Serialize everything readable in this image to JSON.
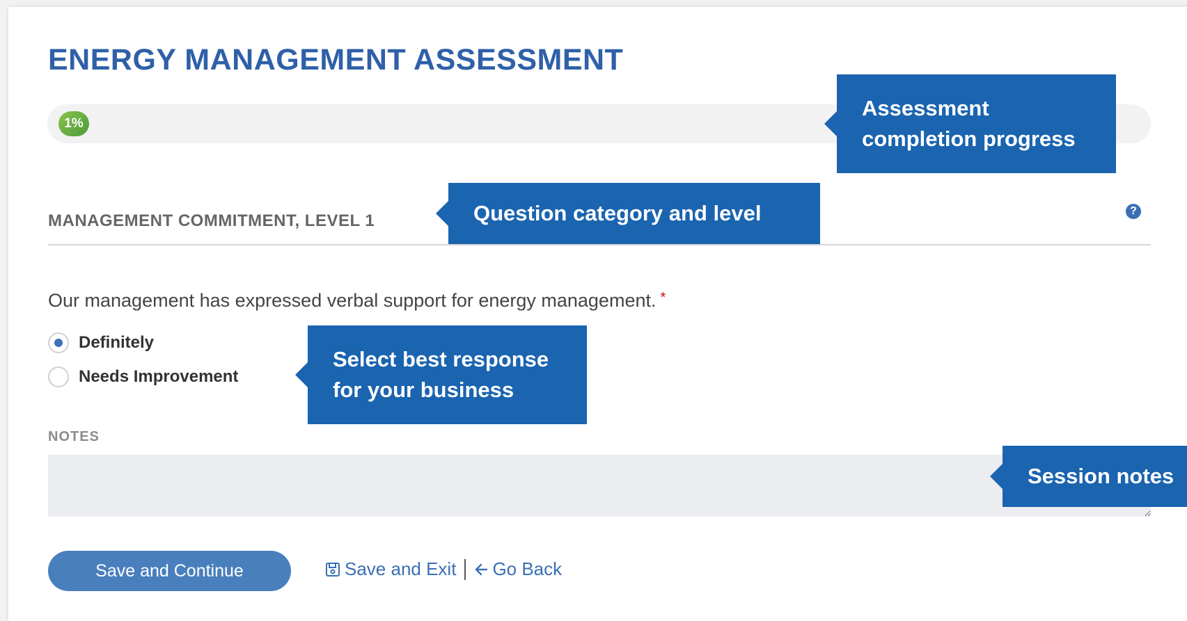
{
  "page": {
    "title": "ENERGY MANAGEMENT ASSESSMENT"
  },
  "progress": {
    "percent": 1,
    "label": "1%",
    "fill_color": "#4a9a3d"
  },
  "section": {
    "category": "MANAGEMENT COMMITMENT, LEVEL 1",
    "help_icon": "help-circle-icon",
    "help_glyph": "?"
  },
  "question": {
    "text": "Our management has expressed verbal support for energy management.",
    "required_marker": "*"
  },
  "options": [
    {
      "label": "Definitely",
      "selected": true
    },
    {
      "label": "Needs Improvement",
      "selected": false
    }
  ],
  "notes": {
    "label": "NOTES",
    "value": "",
    "placeholder": ""
  },
  "actions": {
    "save_continue": "Save and Continue",
    "save_exit": "Save and Exit",
    "go_back": "Go Back",
    "save_icon": "floppy-disk-icon",
    "back_icon": "arrow-left-icon"
  },
  "callouts": {
    "progress_line1": "Assessment",
    "progress_line2": "completion progress",
    "category": "Question category and level",
    "response_line1": "Select best response",
    "response_line2": "for your business",
    "notes": "Session notes"
  },
  "colors": {
    "title": "#2f60a8",
    "callout_bg": "#1a64b0",
    "primary_button": "#4a7fbd",
    "link": "#3a6fb5",
    "required": "#d0021b"
  }
}
